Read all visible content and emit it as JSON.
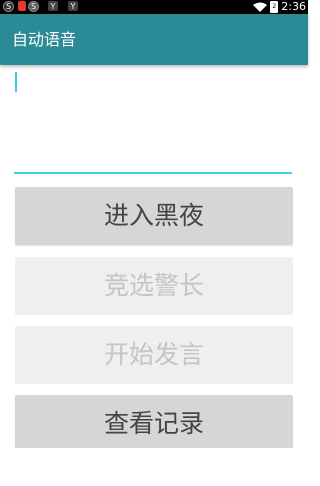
{
  "status_bar": {
    "time": "2:36",
    "battery": "2",
    "left_icons": [
      "circle-s-icon",
      "red-app-icon",
      "circle-s-icon",
      "y-icon",
      "y-icon"
    ]
  },
  "app_bar": {
    "title": "自动语音"
  },
  "input": {
    "value": ""
  },
  "buttons": [
    {
      "label": "进入黑夜",
      "enabled": true
    },
    {
      "label": "竞选警长",
      "enabled": false
    },
    {
      "label": "开始发言",
      "enabled": false
    },
    {
      "label": "查看记录",
      "enabled": true
    }
  ],
  "colors": {
    "app_bar": "#2a8a96",
    "accent": "#3fcfe0",
    "button_enabled": "#d6d6d6",
    "button_disabled": "#efefef"
  }
}
